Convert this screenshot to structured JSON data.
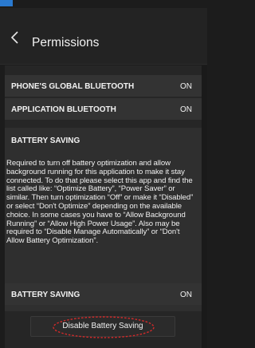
{
  "header": {
    "title": "Permissions"
  },
  "rows": [
    {
      "label": "PHONE'S GLOBAL BLUETOOTH",
      "value": "ON"
    },
    {
      "label": "APPLICATION BLUETOOTH",
      "value": "ON"
    }
  ],
  "battery": {
    "heading": "BATTERY SAVING",
    "description": "Required to turn off battery optimization and allow background running for this application to make it stay connected. To do that please select this app and find the list called like: “Optimize Battery”, “Power Saver” or similar. Then turn optimization “Off” or make it “Disabled” or select “Don't Optimize” depending on the available choice. In some cases you have to “Allow Background Running” or “Allow High Power Usage”. Also may be required to “Disable Manage Automatically” or “Don't Allow Battery Optimization”.",
    "status_label": "BATTERY SAVING",
    "status_value": "ON",
    "button_label": "Disable Battery Saving"
  },
  "colors": {
    "accent_blue": "#2a7ad0",
    "ring_red": "#d42a2a"
  }
}
